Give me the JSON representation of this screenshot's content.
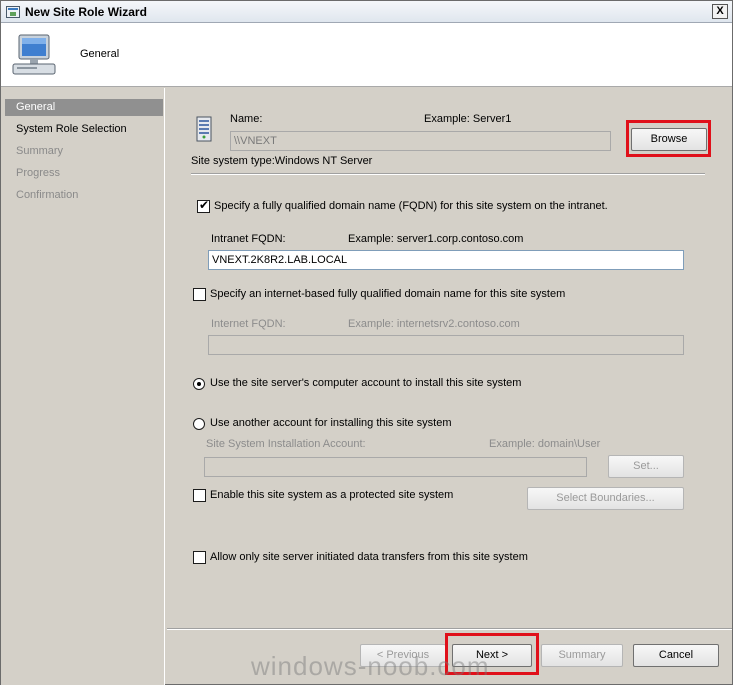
{
  "window": {
    "title": "New Site Role Wizard",
    "close_glyph": "X"
  },
  "header": {
    "heading": "General",
    "icon": "computer-monitor-icon"
  },
  "nav": {
    "items": [
      {
        "label": "General",
        "state": "active"
      },
      {
        "label": "System Role Selection",
        "state": "enabled"
      },
      {
        "label": "Summary",
        "state": "disabled"
      },
      {
        "label": "Progress",
        "state": "disabled"
      },
      {
        "label": "Confirmation",
        "state": "disabled"
      }
    ]
  },
  "general": {
    "name_label": "Name:",
    "name_example": "Example: Server1",
    "name_value": "\\\\VNEXT",
    "browse_label": "Browse",
    "site_system_type": "Site system type:Windows NT Server",
    "fqdn_checkbox_label": "Specify a fully qualified domain name (FQDN) for this site system on the intranet.",
    "fqdn_checked": true,
    "intranet_label": "Intranet FQDN:",
    "intranet_example": "Example: server1.corp.contoso.com",
    "intranet_value": "VNEXT.2K8R2.LAB.LOCAL",
    "internet_checkbox_label": "Specify an internet-based fully qualified domain name for this site system",
    "internet_checked": false,
    "internet_label": "Internet FQDN:",
    "internet_example": "Example: internetsrv2.contoso.com",
    "internet_value": "",
    "radio_computer_account": "Use the site server's computer account to install this site system",
    "radio_other_account": "Use another account for installing this site system",
    "install_account_label": "Site System Installation Account:",
    "install_account_example": "Example: domain\\User",
    "install_account_value": "",
    "set_label": "Set...",
    "protected_label": "Enable this site system as a protected site system",
    "protected_checked": false,
    "boundaries_label": "Select Boundaries...",
    "transfers_label": "Allow only site server initiated data transfers from this site system",
    "transfers_checked": false
  },
  "footer": {
    "previous_label": "< Previous",
    "next_label": "Next >",
    "summary_label": "Summary",
    "cancel_label": "Cancel"
  },
  "watermark": "windows-noob.com",
  "colors": {
    "highlight": "#e0101a",
    "nav_active": "#909090",
    "dialog_bg": "#d4d0c8"
  }
}
